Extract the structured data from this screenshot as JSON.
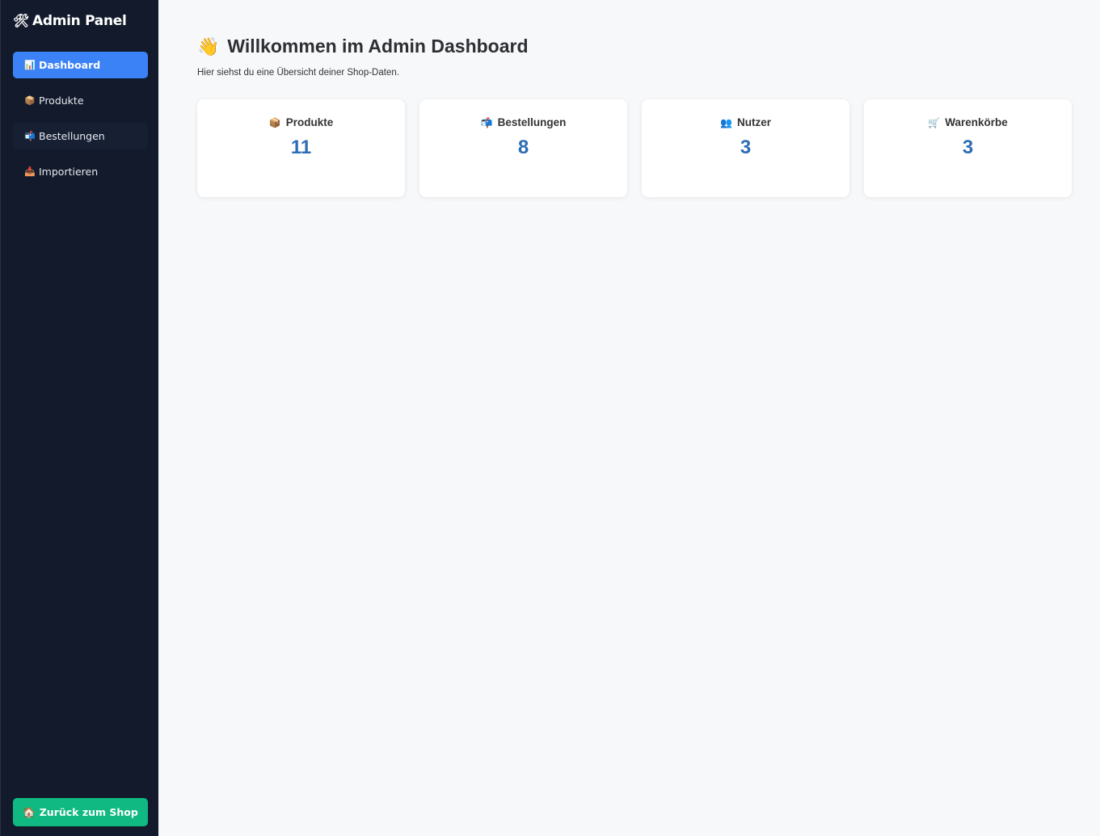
{
  "sidebar": {
    "brand": {
      "icon": "🛠",
      "title": "Admin Panel"
    },
    "items": [
      {
        "icon": "📊",
        "label": "Dashboard",
        "active": true
      },
      {
        "icon": "📦",
        "label": "Produkte",
        "active": false
      },
      {
        "icon": "📬",
        "label": "Bestellungen",
        "active": false
      },
      {
        "icon": "📥",
        "label": "Importieren",
        "active": false
      }
    ],
    "back_button": {
      "icon": "🏠",
      "label": "Zurück zum Shop"
    }
  },
  "main": {
    "title_icon": "👋",
    "title": "Willkommen im Admin Dashboard",
    "subtitle": "Hier siehst du eine Übersicht deiner Shop-Daten.",
    "cards": [
      {
        "icon": "📦",
        "label": "Produkte",
        "value": "11"
      },
      {
        "icon": "📬",
        "label": "Bestellungen",
        "value": "8"
      },
      {
        "icon": "👥",
        "label": "Nutzer",
        "value": "3"
      },
      {
        "icon": "🛒",
        "label": "Warenkörbe",
        "value": "3"
      }
    ]
  },
  "colors": {
    "sidebar_bg": "#121a2b",
    "active_nav": "#3b82f6",
    "back_button": "#10b981",
    "stat_value": "#2f6db3",
    "page_bg": "#f7f8fa"
  }
}
